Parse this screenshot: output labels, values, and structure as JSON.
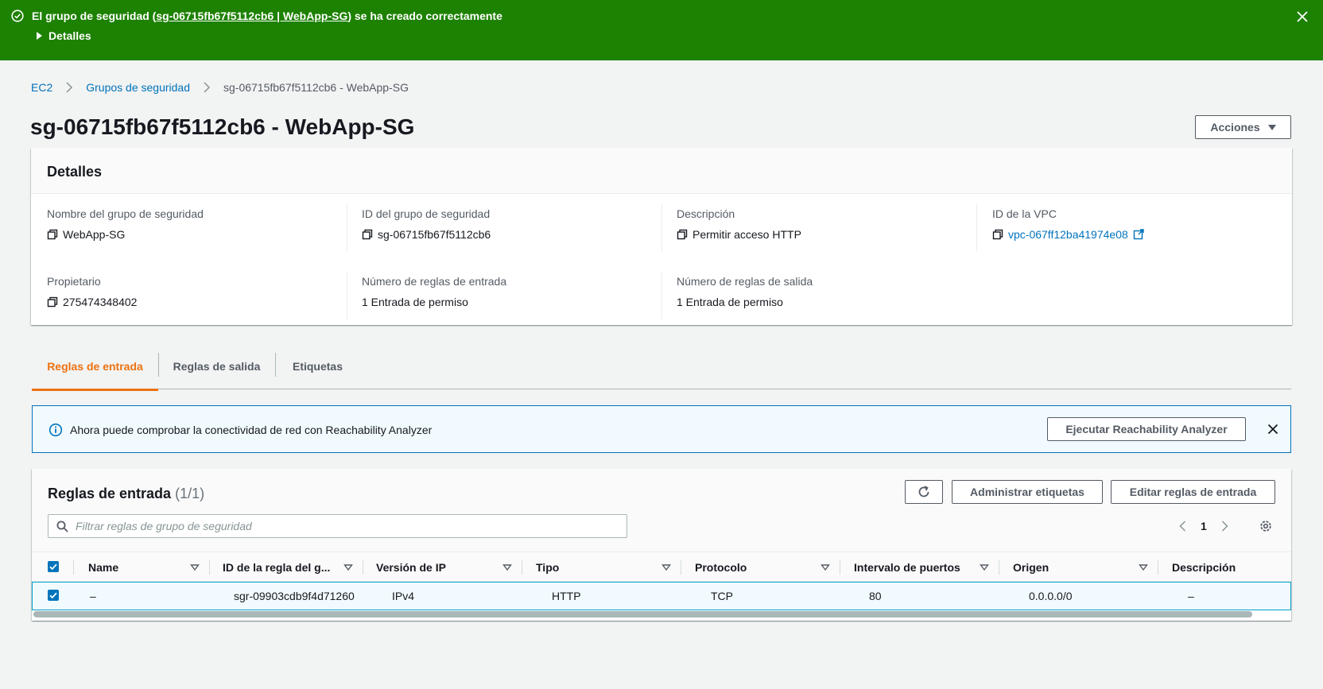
{
  "flash": {
    "message_prefix": "El grupo de seguridad (",
    "message_link": "sg-06715fb67f5112cb6 | WebApp-SG",
    "message_suffix": ") se ha creado correctamente",
    "details_label": "Detalles",
    "color": "#1d8102"
  },
  "breadcrumb": {
    "items": [
      "EC2",
      "Grupos de seguridad"
    ],
    "current": "sg-06715fb67f5112cb6 - WebApp-SG"
  },
  "page": {
    "title": "sg-06715fb67f5112cb6 - WebApp-SG",
    "actions_label": "Acciones"
  },
  "details": {
    "heading": "Detalles",
    "fields": {
      "name": {
        "label": "Nombre del grupo de seguridad",
        "value": "WebApp-SG"
      },
      "sg_id": {
        "label": "ID del grupo de seguridad",
        "value": "sg-06715fb67f5112cb6"
      },
      "description": {
        "label": "Descripción",
        "value": "Permitir acceso HTTP"
      },
      "vpc": {
        "label": "ID de la VPC",
        "value": "vpc-067ff12ba41974e08"
      },
      "owner": {
        "label": "Propietario",
        "value": "275474348402"
      },
      "inbound_count": {
        "label": "Número de reglas de entrada",
        "value": "1 Entrada de permiso"
      },
      "outbound_count": {
        "label": "Número de reglas de salida",
        "value": "1 Entrada de permiso"
      }
    }
  },
  "tabs": [
    "Reglas de entrada",
    "Reglas de salida",
    "Etiquetas"
  ],
  "info_alert": {
    "text": "Ahora puede comprobar la conectividad de red con Reachability Analyzer",
    "button_label": "Ejecutar Reachability Analyzer"
  },
  "rules": {
    "title": "Reglas de entrada",
    "count": "(1/1)",
    "manage_tags_label": "Administrar etiquetas",
    "edit_label": "Editar reglas de entrada",
    "filter_placeholder": "Filtrar reglas de grupo de seguridad",
    "page": "1",
    "columns": [
      "Name",
      "ID de la regla del g...",
      "Versión de IP",
      "Tipo",
      "Protocolo",
      "Intervalo de puertos",
      "Origen",
      "Descripción"
    ],
    "rows": [
      [
        "–",
        "sgr-09903cdb9f4d71260",
        "IPv4",
        "HTTP",
        "TCP",
        "80",
        "0.0.0.0/0",
        "–"
      ]
    ]
  },
  "colors": {
    "link": "#0073bb",
    "active_tab": "#ec7211",
    "info_bg": "#f1faff"
  }
}
